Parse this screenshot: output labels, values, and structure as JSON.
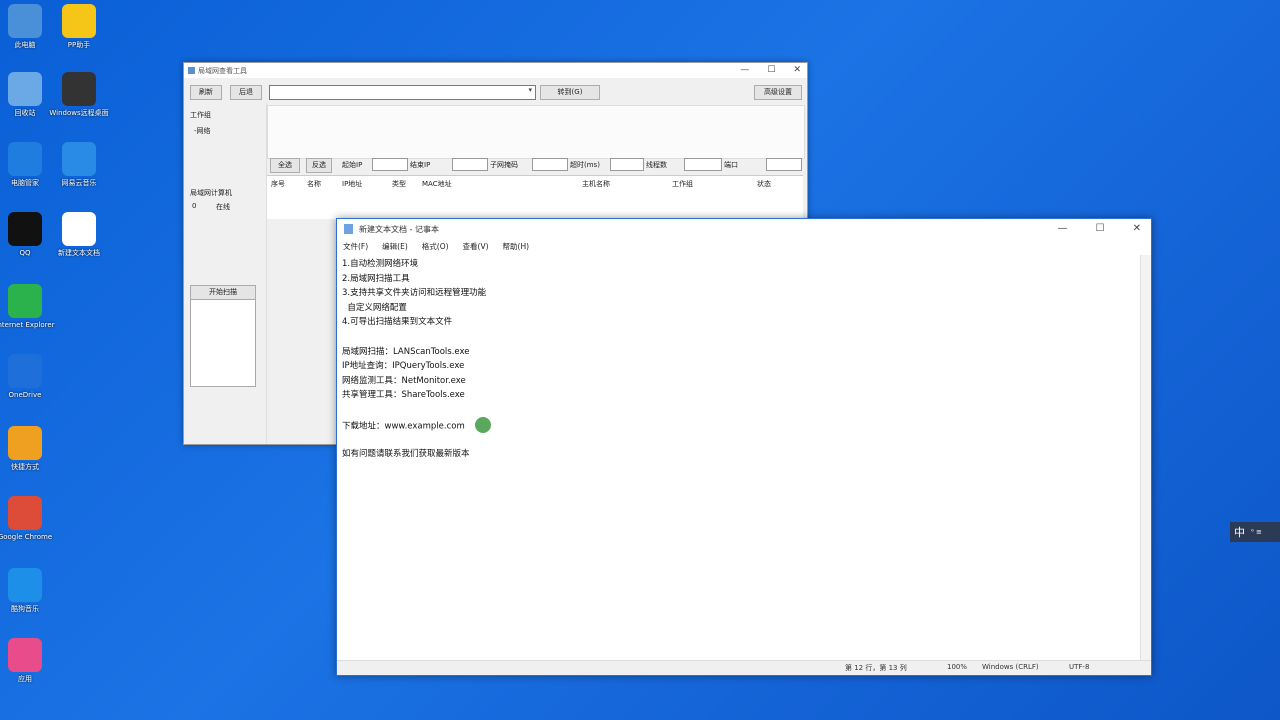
{
  "desktop": {
    "icons": [
      {
        "label": "此电脑",
        "icon": "computer-icon",
        "color": "#4a90d9"
      },
      {
        "label": "PP助手",
        "icon": "pp-assistant-icon",
        "color": "#f5c518"
      },
      {
        "label": "回收站",
        "icon": "recycle-bin-icon",
        "color": "#6aa9e6"
      },
      {
        "label": "Windows远程桌面",
        "icon": "remote-desktop-icon",
        "color": "#333333"
      },
      {
        "label": "电脑管家",
        "icon": "shield-icon",
        "color": "#1f7de0"
      },
      {
        "label": "网易云音乐",
        "icon": "music-icon",
        "color": "#2a8be6"
      },
      {
        "label": "QQ",
        "icon": "qq-icon",
        "color": "#111111"
      },
      {
        "label": "新建文本文档",
        "icon": "text-file-icon",
        "color": "#ffffff"
      },
      {
        "label": "Internet Explorer",
        "icon": "ie-icon",
        "color": "#2bb24c"
      },
      {
        "label": "OneDrive",
        "icon": "cloud-icon",
        "color": "#1e6fd9"
      },
      {
        "label": "快捷方式",
        "icon": "app-icon",
        "color": "#f0a020"
      },
      {
        "label": "Google Chrome",
        "icon": "chrome-icon",
        "color": "#dd4b39"
      },
      {
        "label": "酷狗音乐",
        "icon": "kugou-icon",
        "color": "#1d8fe8"
      },
      {
        "label": "应用",
        "icon": "pinwheel-icon",
        "color": "#e84c8a"
      }
    ]
  },
  "back_window": {
    "title": "局域网查看工具",
    "buttons": {
      "refresh": "刷新",
      "back": "后退",
      "go": "转到(G)",
      "settings": "高级设置"
    },
    "left_labels": [
      "工作组",
      "-网络"
    ],
    "filter_buttons": [
      "全选",
      "反选"
    ],
    "filter_labels": [
      "起始IP",
      "结束IP",
      "子网掩码",
      "超时(ms)",
      "线程数",
      "端口"
    ],
    "grid_headers": [
      "序号",
      "名称",
      "IP地址",
      "类型",
      "MAC地址",
      "主机名称",
      "工作组",
      "状态"
    ],
    "side_label": "局域网计算机",
    "side_values": [
      "0",
      "在线"
    ],
    "action_button": "开始扫描"
  },
  "notepad": {
    "title": "新建文本文档 - 记事本",
    "menu": [
      "文件(F)",
      "编辑(E)",
      "格式(O)",
      "查看(V)",
      "帮助(H)"
    ],
    "lines": [
      "1.自动检测网络环境",
      "2.局域网扫描工具",
      "3.支持共享文件夹访问和远程管理功能",
      "  自定义网络配置",
      "4.可导出扫描结果到文本文件",
      "",
      "局域网扫描：LANScanTools.exe",
      "IP地址查询：IPQueryTools.exe",
      "网络监测工具：NetMonitor.exe",
      "共享管理工具：ShareTools.exe",
      "",
      "下载地址：www.example.com",
      "",
      "如有问题请联系我们获取最新版本"
    ],
    "cursor_line_index": 11,
    "status": {
      "position": "第 12 行，第 13 列",
      "zoom": "100%",
      "eol": "Windows (CRLF)",
      "encoding": "UTF-8"
    }
  },
  "ime": {
    "label": "中"
  }
}
